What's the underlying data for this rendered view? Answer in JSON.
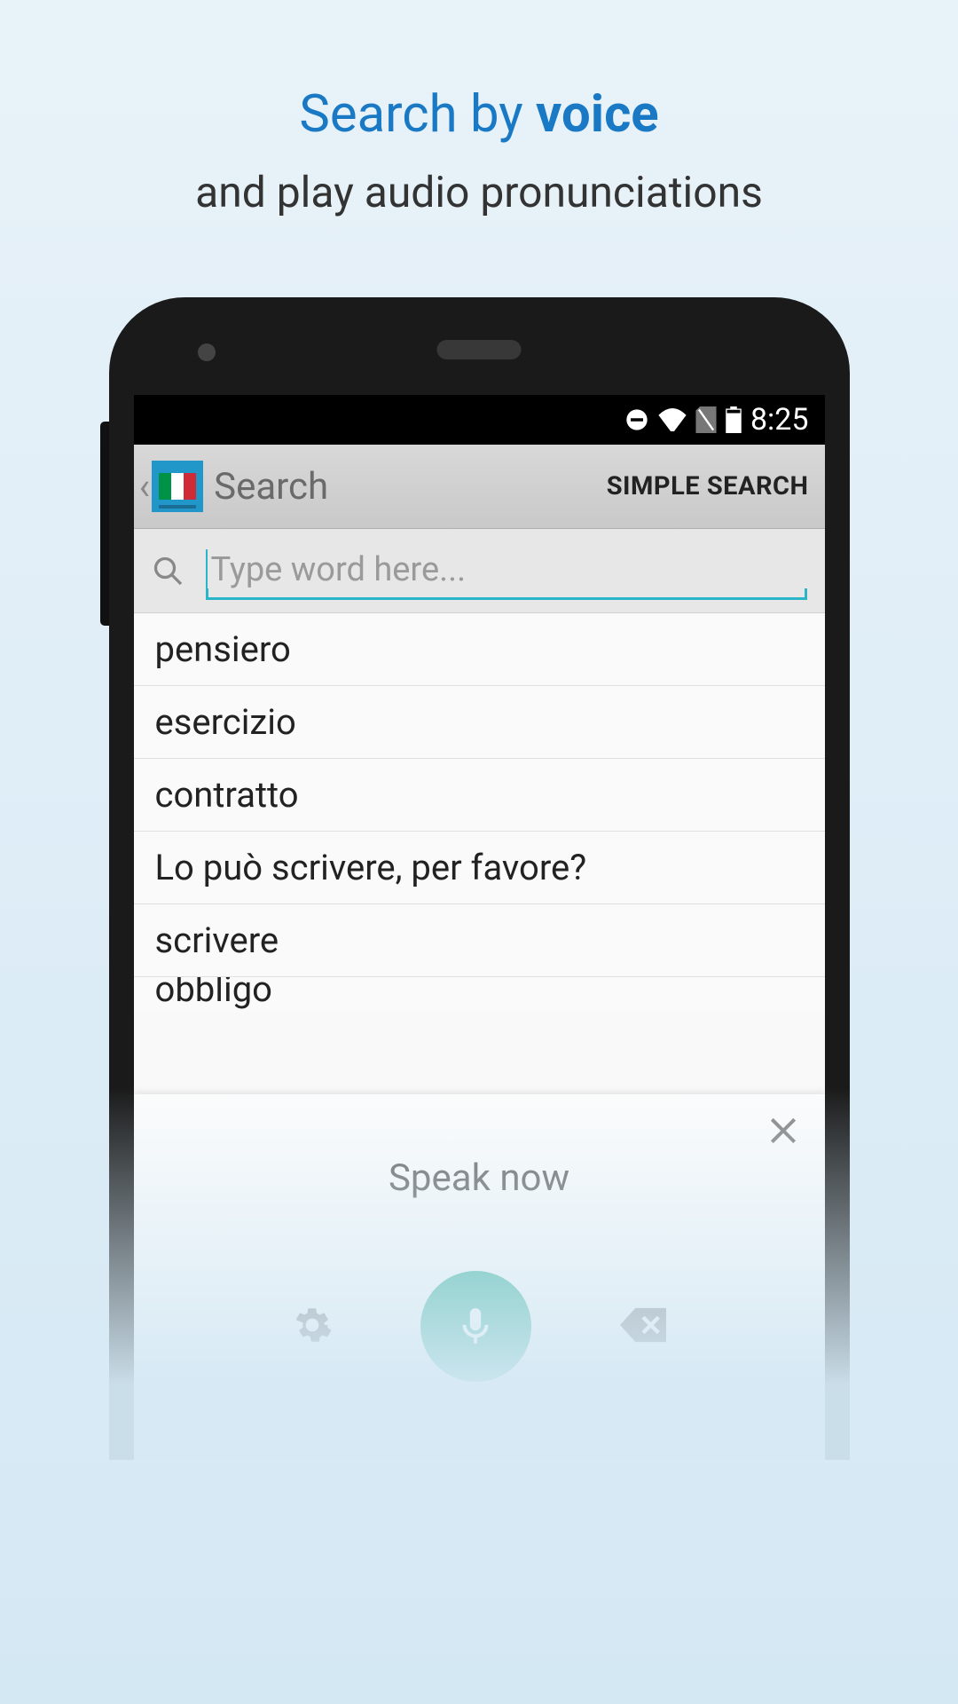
{
  "promo": {
    "title_prefix": "Search by ",
    "title_bold": "voice",
    "subtitle": "and play audio pronunciations"
  },
  "status_bar": {
    "time": "8:25"
  },
  "app_bar": {
    "title": "Search",
    "action": "SIMPLE SEARCH"
  },
  "search": {
    "placeholder": "Type word here..."
  },
  "words": [
    "pensiero",
    "esercizio",
    "contratto",
    "Lo può scrivere, per favore?",
    "scrivere"
  ],
  "partial_word": "obbligo",
  "voice_panel": {
    "title": "Speak now"
  }
}
